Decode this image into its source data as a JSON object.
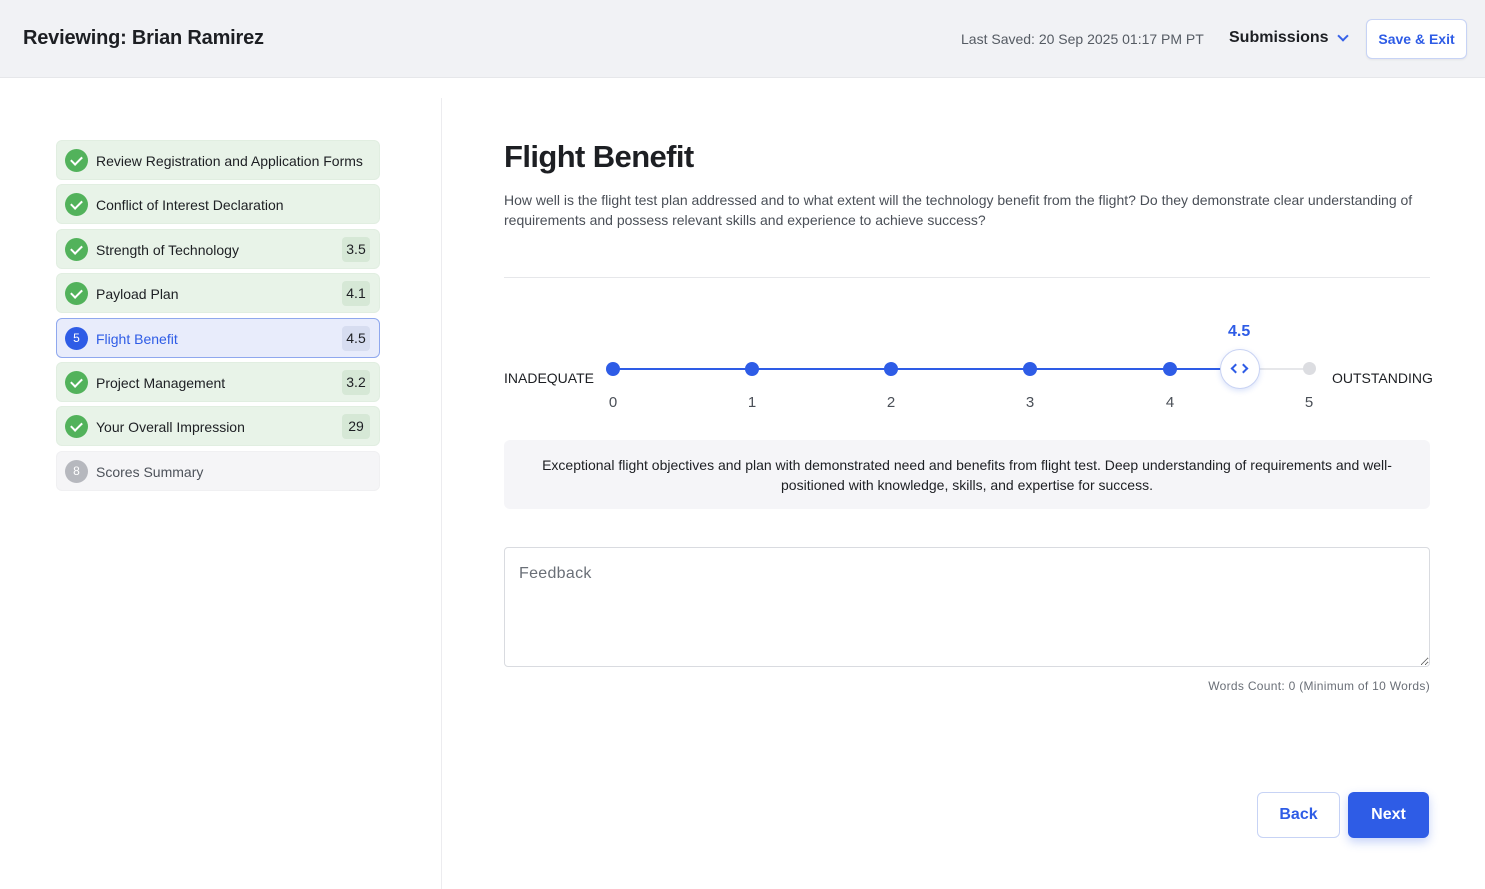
{
  "header": {
    "title": "Reviewing: Brian Ramirez",
    "last_saved": "Last Saved: 20 Sep 2025 01:17 PM PT",
    "submissions_label": "Submissions",
    "save_exit_label": "Save & Exit"
  },
  "sidebar": {
    "items": [
      {
        "label": "Review Registration and Application Forms",
        "score": "",
        "status": "complete"
      },
      {
        "label": "Conflict of Interest Declaration",
        "score": "",
        "status": "complete"
      },
      {
        "label": "Strength of Technology",
        "score": "3.5",
        "status": "complete"
      },
      {
        "label": "Payload Plan",
        "score": "4.1",
        "status": "complete"
      },
      {
        "label": "Flight Benefit",
        "score": "4.5",
        "status": "active",
        "number": "5"
      },
      {
        "label": "Project Management",
        "score": "3.2",
        "status": "complete"
      },
      {
        "label": "Your Overall Impression",
        "score": "29",
        "status": "complete"
      },
      {
        "label": "Scores Summary",
        "score": "",
        "status": "pending",
        "number": "8"
      }
    ]
  },
  "main": {
    "title": "Flight Benefit",
    "question": "How well is the flight test plan addressed and to what extent will the technology benefit from the flight? Do they demonstrate clear understanding of requirements and possess relevant skills and experience to achieve success?",
    "scale": {
      "min_label": "INADEQUATE",
      "max_label": "OUTSTANDING",
      "ticks": [
        "0",
        "1",
        "2",
        "3",
        "4",
        "5"
      ],
      "value": "4.5"
    },
    "descriptor": "Exceptional flight objectives and plan with demonstrated need and benefits from flight test. Deep understanding of requirements and well-positioned with knowledge, skills, and expertise for success.",
    "feedback": {
      "placeholder": "Feedback",
      "value": ""
    },
    "word_count": "Words Count: 0 (Minimum of 10 Words)",
    "back_label": "Back",
    "next_label": "Next"
  },
  "colors": {
    "accent": "#2e5ce6",
    "complete": "#52b25b",
    "complete_bg": "#e8f3e8",
    "active_bg": "#e8ecfb"
  }
}
